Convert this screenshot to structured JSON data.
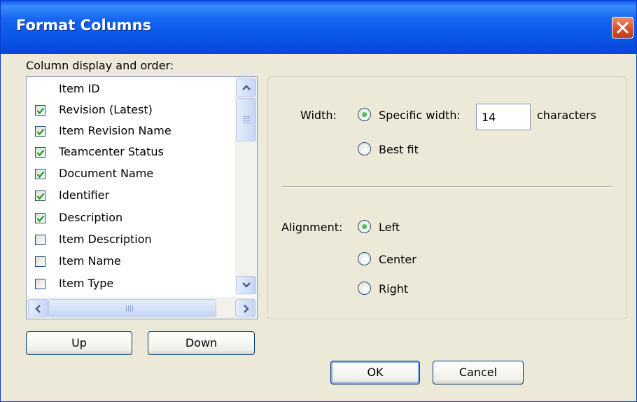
{
  "window": {
    "title": "Format Columns"
  },
  "columns": {
    "label": "Column display and order:",
    "items": [
      {
        "label": "Item ID",
        "checked": null
      },
      {
        "label": "Revision (Latest)",
        "checked": true
      },
      {
        "label": "Item Revision Name",
        "checked": true
      },
      {
        "label": "Teamcenter Status",
        "checked": true
      },
      {
        "label": "Document Name",
        "checked": true
      },
      {
        "label": "Identifier",
        "checked": true
      },
      {
        "label": "Description",
        "checked": true
      },
      {
        "label": "Item Description",
        "checked": false
      },
      {
        "label": "Item Name",
        "checked": false
      },
      {
        "label": "Item Type",
        "checked": false
      }
    ]
  },
  "buttons": {
    "up": "Up",
    "down": "Down",
    "ok": "OK",
    "cancel": "Cancel"
  },
  "width": {
    "label": "Width:",
    "specific_label": "Specific width:",
    "value": "14",
    "units": "characters",
    "best_fit_label": "Best fit",
    "selected": "specific"
  },
  "alignment": {
    "label": "Alignment:",
    "options": [
      "Left",
      "Center",
      "Right"
    ],
    "selected": "Left"
  },
  "colors": {
    "title_bar": "#0a55e6",
    "dialog_bg": "#ece9d8",
    "checkmark": "#21a121",
    "close_button": "#d4502e"
  },
  "icons": [
    "close-icon",
    "scroll-up-arrow-icon",
    "scroll-down-arrow-icon",
    "scroll-left-arrow-icon",
    "scroll-right-arrow-icon",
    "checkmark-icon"
  ]
}
